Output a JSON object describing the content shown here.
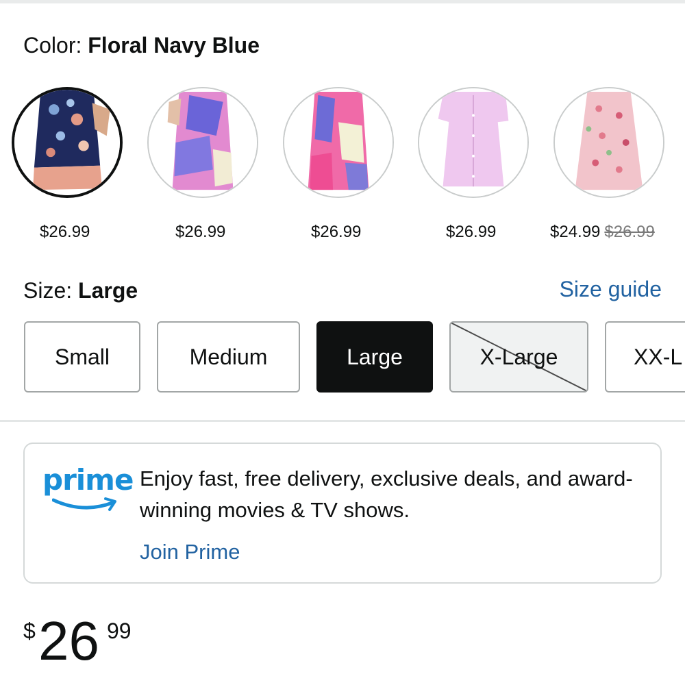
{
  "color_section": {
    "label": "Color:",
    "selected": "Floral Navy Blue"
  },
  "swatches": [
    {
      "price": "$26.99",
      "image": "floral-navy-dress",
      "selected": true
    },
    {
      "price": "$26.99",
      "image": "tie-dye-purple-pink-dress",
      "selected": false
    },
    {
      "price": "$26.99",
      "image": "tie-dye-pink-blue-dress",
      "selected": false
    },
    {
      "price": "$26.99",
      "image": "light-pink-button-dress",
      "selected": false
    },
    {
      "price": "$24.99",
      "original_price": "$26.99",
      "image": "pink-floral-dress",
      "selected": false
    }
  ],
  "size_section": {
    "label": "Size:",
    "selected": "Large",
    "guide_link": "Size guide"
  },
  "sizes": [
    {
      "label": "Small",
      "state": "available"
    },
    {
      "label": "Medium",
      "state": "available"
    },
    {
      "label": "Large",
      "state": "selected"
    },
    {
      "label": "X-Large",
      "state": "unavailable"
    },
    {
      "label": "XX-L",
      "state": "available"
    }
  ],
  "prime": {
    "logo_text": "prime",
    "message": "Enjoy fast, free delivery, exclusive deals, and award-winning movies & TV shows.",
    "link": "Join Prime"
  },
  "main_price": {
    "symbol": "$",
    "whole": "26",
    "fraction": "99"
  },
  "colors": {
    "link": "#2162a1",
    "prime_blue": "#1a8fd8",
    "selected_bg": "#0f1111"
  }
}
